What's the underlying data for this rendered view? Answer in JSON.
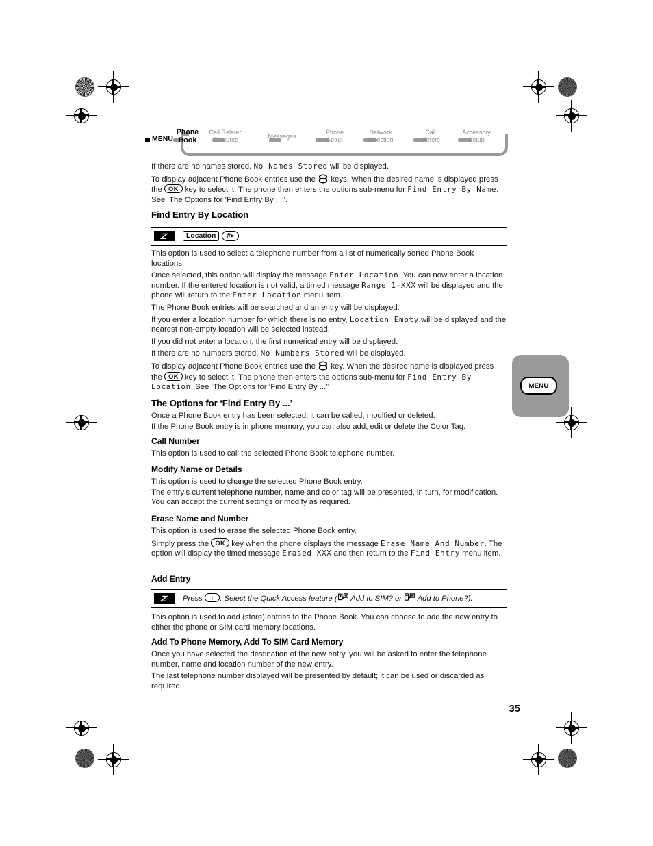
{
  "document": {
    "page_number": "35",
    "thumb_tab_label": "MENU"
  },
  "menu_map": {
    "root_label": "MENU",
    "nodes": [
      {
        "label_line1": "Phone",
        "label_line2": "Book",
        "active": true
      },
      {
        "label_line1": "Call Related",
        "label_line2": "Features",
        "active": false
      },
      {
        "label_line1": "Messages",
        "label_line2": "",
        "active": false
      },
      {
        "label_line1": "Phone",
        "label_line2": "Setup",
        "active": false
      },
      {
        "label_line1": "Network",
        "label_line2": "Selection",
        "active": false
      },
      {
        "label_line1": "Call",
        "label_line2": "Meters",
        "active": false
      },
      {
        "label_line1": "Accessory",
        "label_line2": "Setup",
        "active": false
      }
    ]
  },
  "intro": {
    "p1_a": "If there are no names stored, ",
    "p1_lcd": "No Names Stored",
    "p1_b": " will be displayed.",
    "p2_a": "To display adjacent Phone Book entries use the ",
    "p2_b": " keys. When the desired name is displayed press the ",
    "p2_ok": "OK",
    "p2_c": " key to select it. The phone then enters the options sub-menu for ",
    "p2_lcd": "Find Entry By Name",
    "p2_d": ". See ‘The Options for ‘Find Entry By ...’’."
  },
  "find_by_location": {
    "heading": "Find Entry By Location",
    "tip": {
      "icon": "quick-access-bolt-icon",
      "chip_label": "Location",
      "pill_label": "#▸"
    },
    "p1": "This option is used to select a telephone number from a list of numerically sorted Phone Book locations.",
    "p2_a": "Once selected, this option will display the message ",
    "p2_lcd1": "Enter Location",
    "p2_b": ". You can now enter a location number. If the entered location is not valid, a timed message ",
    "p2_lcd2": "Range 1-XXX",
    "p2_c": " will be displayed and the phone will return to the ",
    "p2_lcd3": "Enter Location",
    "p2_d": " menu item.",
    "p3": "The Phone Book entries will be searched and an entry will be displayed.",
    "p4_a": "If you enter a location number for which there is no entry, ",
    "p4_lcd": "Location Empty",
    "p4_b": " will be displayed and the nearest non-empty location will be selected instead.",
    "p5": "If you did not enter a location, the first numerical entry will be displayed.",
    "p6_a": "If there are no numbers stored, ",
    "p6_lcd": "No Numbers Stored",
    "p6_b": " will be displayed.",
    "p7_a": "To display adjacent Phone Book entries use the ",
    "p7_b": " key. When the desired name is displayed press the ",
    "p7_ok": "OK",
    "p7_c": " key to select it. The phone then enters the options sub-menu for ",
    "p7_lcd": "Find Entry By Location",
    "p7_d": ". See ‘The Options for ‘Find Entry By ...’’"
  },
  "options_section": {
    "heading": "The Options for ‘Find Entry By ...’",
    "p1": "Once a Phone Book entry has been selected, it can be called, modified or deleted.",
    "p2": "If the Phone Book entry is in phone memory, you can also add, edit or delete the Color Tag."
  },
  "call_number": {
    "heading": "Call Number",
    "p1": "This option is used to call the selected Phone Book telephone number."
  },
  "modify_name": {
    "heading": "Modify Name or Details",
    "p1": "This option is used to change the selected Phone Book entry.",
    "p2": "The entry’s current telephone number, name and color tag will be presented, in turn, for modification. You can accept the current settings or modify as required."
  },
  "erase_name": {
    "heading": "Erase Name and Number",
    "p1": "This option is used to erase the selected Phone Book entry.",
    "p2_a": "Simply press the ",
    "p2_ok": "OK",
    "p2_b": " key when the phone displays the message ",
    "p2_lcd1": "Erase Name And Number",
    "p2_c": ". The option will display the timed message ",
    "p2_lcd2": "Erased XXX",
    "p2_d": " and then return to the ",
    "p2_lcd3": "Find Entry",
    "p2_e": " menu item."
  },
  "add_entry": {
    "heading": "Add Entry",
    "tip": {
      "icon": "quick-access-bolt-icon",
      "text_a": "Press ",
      "key_up": "↑",
      "text_b": ". Select the Quick Access feature (",
      "sim_icon": "add-to-sim-icon",
      "text_c": " Add to SIM? or ",
      "phone_icon": "add-to-phone-icon",
      "text_d": " Add to Phone?)."
    },
    "p1": "This option is used to add (store) entries to the Phone Book. You can choose to add the new entry to either the phone or SIM card memory locations."
  },
  "add_to_memory": {
    "heading": "Add To Phone Memory, Add To SIM Card Memory",
    "p1": "Once you have selected the destination of the new entry, you will be asked to enter the telephone number, name and location number of the new entry.",
    "p2": "The last telephone number displayed will be presented by default; it can be used or discarded as required."
  },
  "colors": {
    "menu_gray": "#9a9a9a",
    "body_text": "#1a1a1a",
    "tab_gray": "#9a9a9a"
  }
}
